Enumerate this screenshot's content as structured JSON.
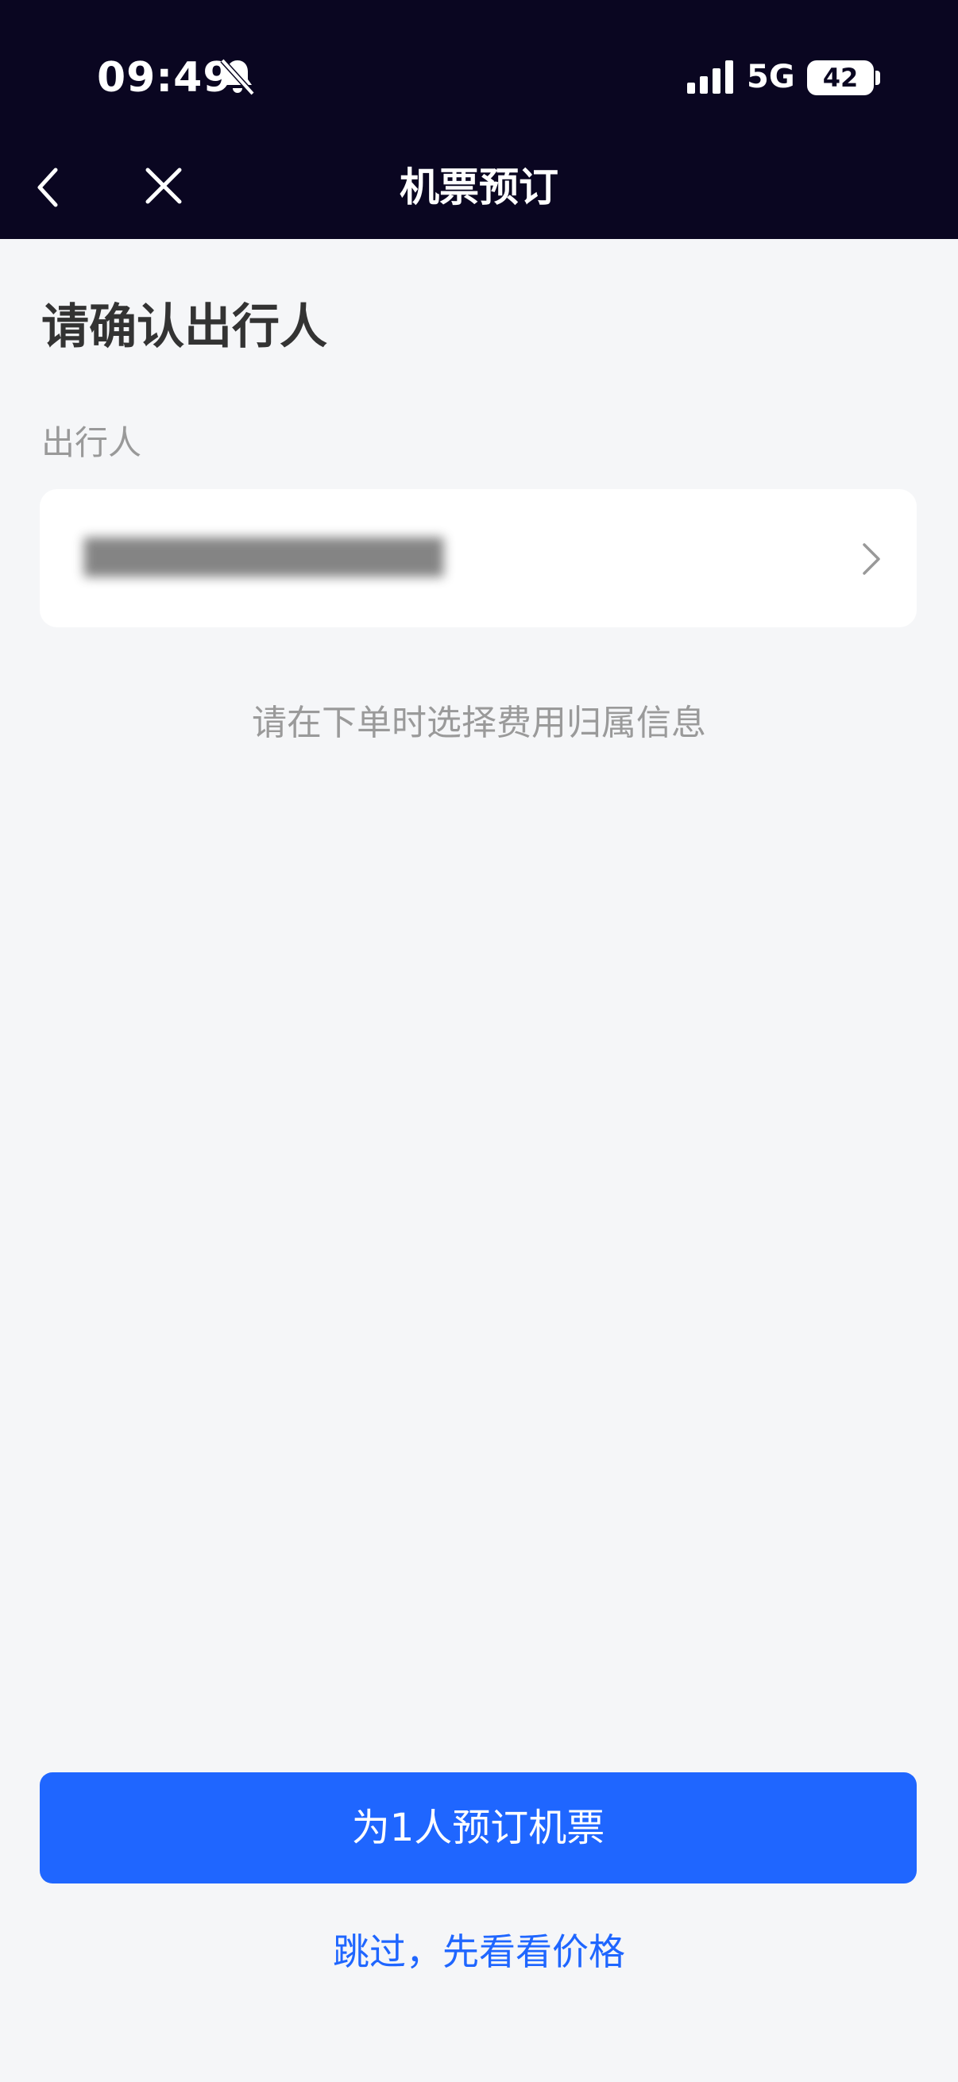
{
  "status_bar": {
    "time": "09:49",
    "network": "5G",
    "battery": "42",
    "icons": [
      "bell-muted-icon",
      "signal-icon",
      "battery-icon"
    ]
  },
  "nav": {
    "title": "机票预订",
    "back_icon": "chevron-left-icon",
    "close_icon": "close-icon"
  },
  "page": {
    "title": "请确认出行人",
    "traveler_section_label": "出行人",
    "traveler_name": "██████████████",
    "traveler_chevron_icon": "chevron-right-icon",
    "cost_hint": "请在下单时选择费用归属信息"
  },
  "actions": {
    "book_label": "为1人预订机票",
    "skip_label": "跳过，先看看价格"
  },
  "colors": {
    "header_bg": "#0a0621",
    "page_bg": "#f5f6f8",
    "accent": "#1f66ff",
    "title_text": "#333333",
    "muted_text": "#999999"
  }
}
